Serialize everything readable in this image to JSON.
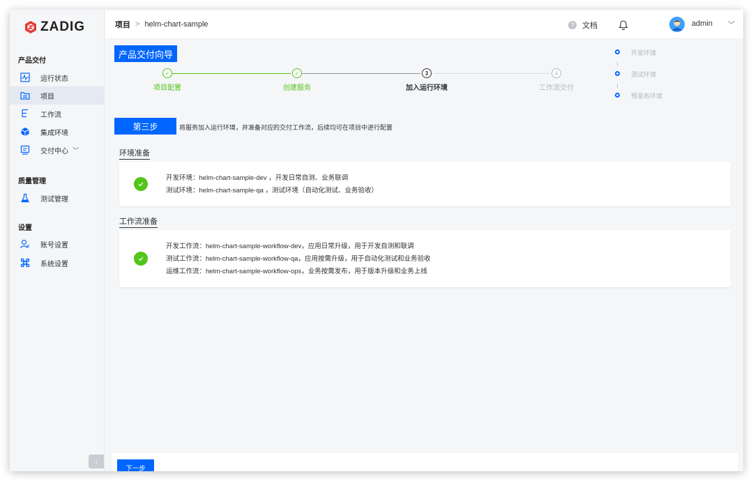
{
  "app": {
    "name": "ZADIG"
  },
  "sidebar": {
    "groups": [
      {
        "title": "产品交付"
      },
      {
        "title": "质量管理"
      },
      {
        "title": "设置"
      }
    ],
    "items": [
      {
        "label": "运行状态",
        "icon": "activity-icon"
      },
      {
        "label": "项目",
        "icon": "folder-icon"
      },
      {
        "label": "工作流",
        "icon": "workflow-icon"
      },
      {
        "label": "集成环境",
        "icon": "cube-icon"
      },
      {
        "label": "交付中心",
        "icon": "delivery-icon"
      },
      {
        "label": "测试管理",
        "icon": "flask-icon"
      },
      {
        "label": "账号设置",
        "icon": "user-settings-icon"
      },
      {
        "label": "系统设置",
        "icon": "command-icon"
      }
    ],
    "collapse_label": "‹"
  },
  "header": {
    "breadcrumb_root": "项目",
    "breadcrumb_sep": ">",
    "breadcrumb_current": "helm-chart-sample",
    "help_glyph": "?",
    "docs_label": "文档",
    "username": "admin"
  },
  "wizard": {
    "title": "产品交付向导",
    "steps": [
      {
        "label": "项目配置",
        "marker": "✓",
        "state": "done"
      },
      {
        "label": "创建服务",
        "marker": "✓",
        "state": "done"
      },
      {
        "label": "加入运行环境",
        "marker": "3",
        "state": "active"
      },
      {
        "label": "工作流交付",
        "marker": "4",
        "state": "pending"
      }
    ],
    "side_envs": [
      "开发环境",
      "测试环境",
      "预发布环境"
    ],
    "step_badge": "第三步",
    "step_description": "将服务加入运行环境，并准备对应的交付工作流，后续均可在项目中进行配置"
  },
  "env_section": {
    "title": "环境准备",
    "lines": [
      "开发环境：helm-chart-sample-dev ，开发日常自测、业务联调",
      "测试环境：helm-chart-sample-qa ，测试环境（自动化测试、业务验收）"
    ]
  },
  "workflow_section": {
    "title": "工作流准备",
    "lines": [
      "开发工作流：helm-chart-sample-workflow-dev，应用日常升级，用于开发自测和联调",
      "测试工作流：helm-chart-sample-workflow-qa，应用按需升级，用于自动化测试和业务验收",
      "运维工作流：helm-chart-sample-workflow-ops，业务按需发布，用于版本升级和业务上线"
    ]
  },
  "footer": {
    "next_label": "下一步"
  },
  "colors": {
    "primary": "#0066ff",
    "success": "#52c41a",
    "pending": "#b4b7bd"
  }
}
